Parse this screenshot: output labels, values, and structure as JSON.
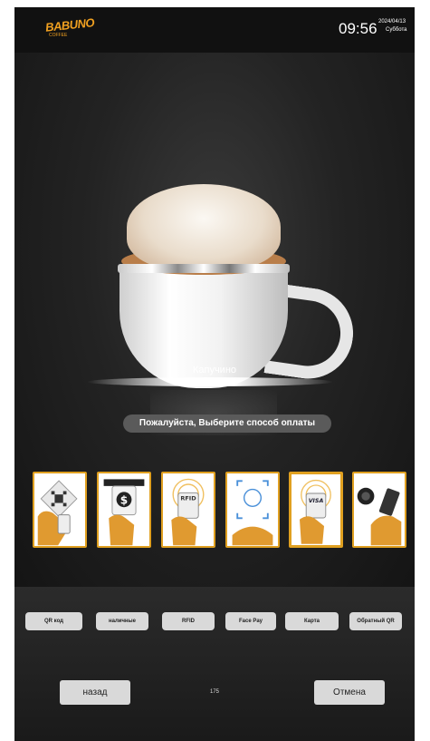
{
  "header": {
    "brand": "BABUNO",
    "brand_sub": "COFFEE",
    "time": "09:56",
    "date": "2024/04/13",
    "weekday": "Суббота"
  },
  "product": {
    "name": "Капучино",
    "price": "₽ 1.00"
  },
  "prompt": "Пожалуйста, Выберите способ оплаты",
  "payment_methods": [
    {
      "label": "QR код",
      "icon": "qr-scan-icon"
    },
    {
      "label": "наличные",
      "icon": "cash-icon"
    },
    {
      "label": "RFID",
      "icon": "rfid-card-icon"
    },
    {
      "label": "Face Pay",
      "icon": "face-pay-icon"
    },
    {
      "label": "Карта",
      "icon": "visa-card-icon"
    },
    {
      "label": "Обратный QR",
      "icon": "reverse-qr-icon"
    }
  ],
  "footer": {
    "back": "назад",
    "countdown": "175",
    "cancel": "Отмена"
  },
  "colors": {
    "accent": "#e0a020",
    "background": "#1d1d1d",
    "button": "#d9d9d9"
  }
}
